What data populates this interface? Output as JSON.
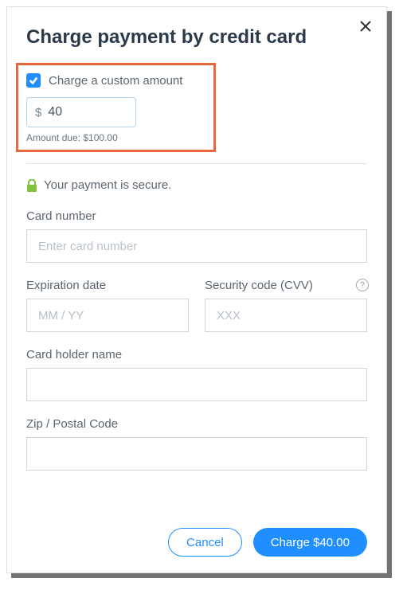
{
  "modal": {
    "title": "Charge payment by credit card",
    "custom_amount": {
      "checkbox_label": "Charge a custom amount",
      "currency_prefix": "$",
      "value": "40",
      "amount_due_text": "Amount due: $100.00"
    },
    "secure_text": "Your payment is secure.",
    "fields": {
      "card_number": {
        "label": "Card number",
        "placeholder": "Enter card number"
      },
      "expiration": {
        "label": "Expiration date",
        "placeholder": "MM / YY"
      },
      "cvv": {
        "label": "Security code (CVV)",
        "placeholder": "XXX",
        "help": "?"
      },
      "card_holder": {
        "label": "Card holder name"
      },
      "zip": {
        "label": "Zip / Postal Code"
      }
    },
    "buttons": {
      "cancel": "Cancel",
      "charge": "Charge $40.00"
    }
  }
}
